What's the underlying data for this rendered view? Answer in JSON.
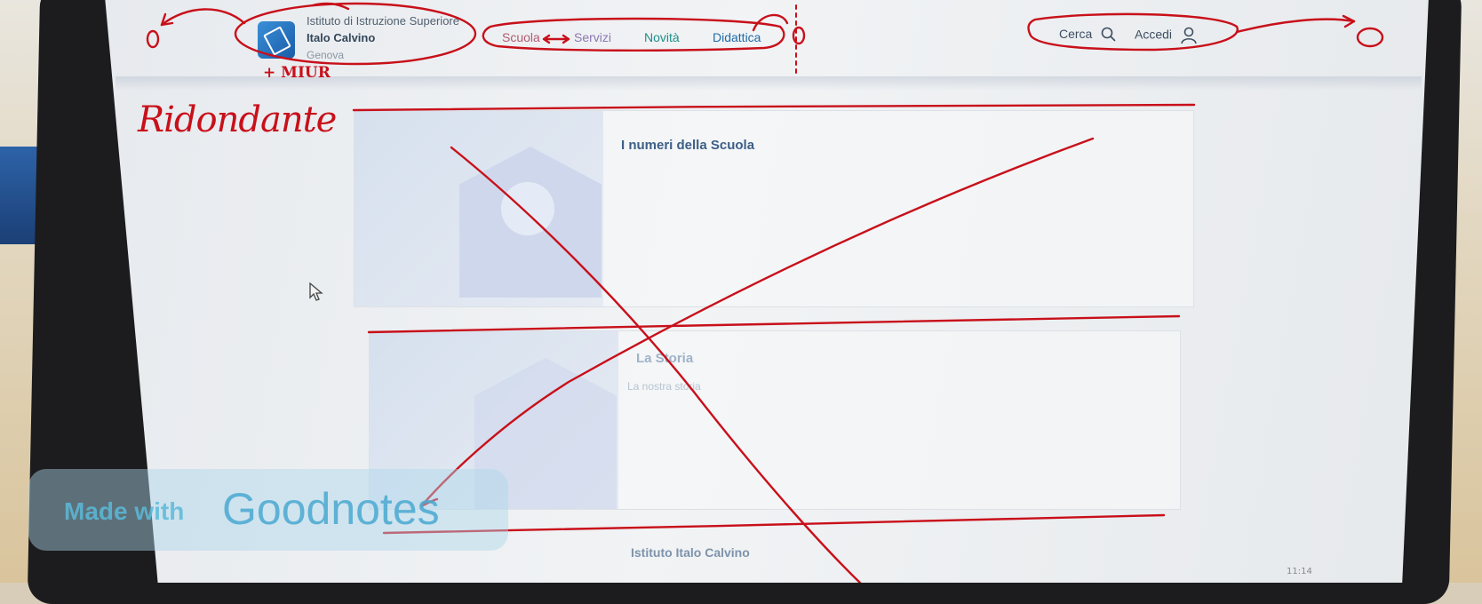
{
  "header": {
    "school_line1": "Istituto di Istruzione Superiore",
    "school_line2": "Italo Calvino",
    "school_line3": "Genova",
    "nav": [
      "Scuola",
      "Servizi",
      "Novità",
      "Didattica"
    ],
    "search_label": "Cerca",
    "login_label": "Accedi"
  },
  "cards": [
    {
      "title": "I numeri della Scuola"
    },
    {
      "title": "La Storia",
      "subtitle": "La nostra storia"
    }
  ],
  "footer_title": "Istituto Italo Calvino",
  "taskbar_time": "11:14",
  "annotations": {
    "redundant": "Ridondante",
    "miur": "+ MIUR"
  },
  "watermark": {
    "made_with": "Made with",
    "brand": "Goodnotes"
  },
  "colors": {
    "ink": "#c8101a",
    "nav_scuola": "#b25c6e",
    "nav_servizi": "#8c77b2",
    "nav_novita": "#1d8f88",
    "nav_didattica": "#1f6aa8",
    "title_blue": "#3c5f86"
  }
}
